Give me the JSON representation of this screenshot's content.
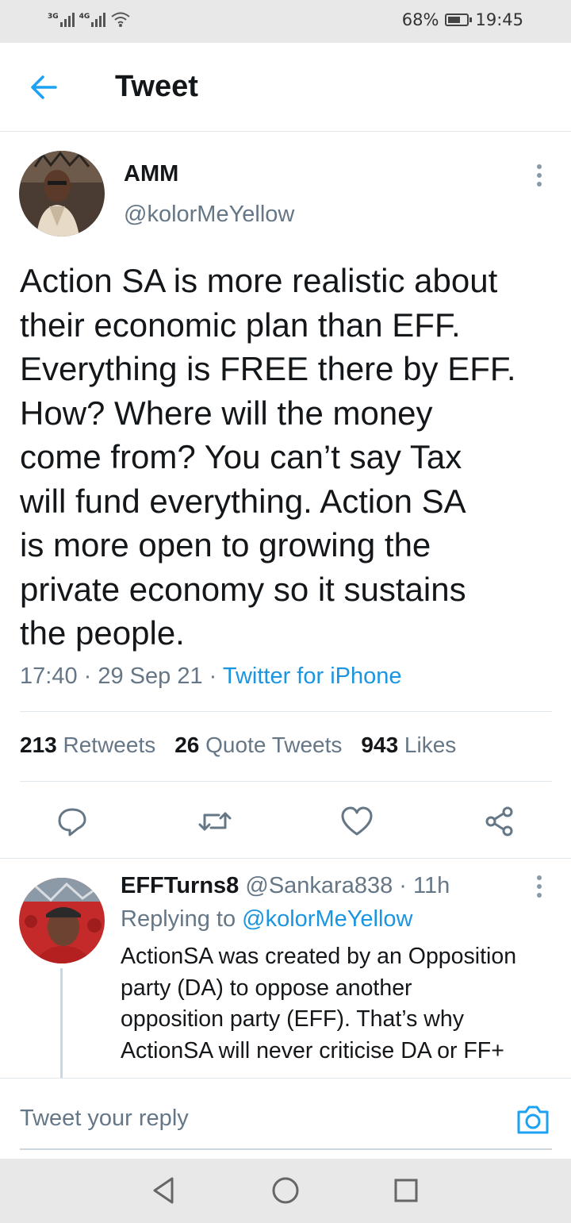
{
  "status_bar": {
    "signal1_tag": "3G",
    "signal2_tag": "4G",
    "battery_text": "68%",
    "battery_level": 0.68,
    "time": "19:45"
  },
  "header": {
    "title": "Tweet",
    "back_icon": "arrow-left-icon"
  },
  "tweet": {
    "author_name": "AMM",
    "author_handle": "@kolorMeYellow",
    "text": "Action SA is more realistic about\ntheir economic plan than EFF.\nEverything is FREE there by EFF.\nHow? Where will the money\ncome from? You can’t say Tax\nwill fund everything. Action SA\nis more open to growing the\nprivate economy so it sustains\nthe people.",
    "time": "17:40",
    "date": "29 Sep 21",
    "source": "Twitter for iPhone",
    "separator": " · ",
    "stats": {
      "retweets_count": "213",
      "retweets_label": "Retweets",
      "quotes_count": "26",
      "quotes_label": "Quote Tweets",
      "likes_count": "943",
      "likes_label": "Likes"
    },
    "actions": [
      "reply-icon",
      "retweet-icon",
      "like-icon",
      "share-icon"
    ]
  },
  "reply": {
    "author_name": "EFFTurns8",
    "author_handle": "@Sankara838",
    "age": "11h",
    "separator": " · ",
    "replying_prefix": "Replying to",
    "replying_to": "@kolorMeYellow",
    "text": "ActionSA was created by an Opposition\nparty (DA) to oppose another\nopposition party (EFF).  That’s why\nActionSA will never criticise DA or FF+"
  },
  "compose": {
    "placeholder": "Tweet your reply",
    "camera_icon": "camera-icon"
  },
  "colors": {
    "accent": "#1b95e0",
    "secondary_text": "#657786",
    "primary_text": "#14171a",
    "divider": "#e1e8ed"
  }
}
